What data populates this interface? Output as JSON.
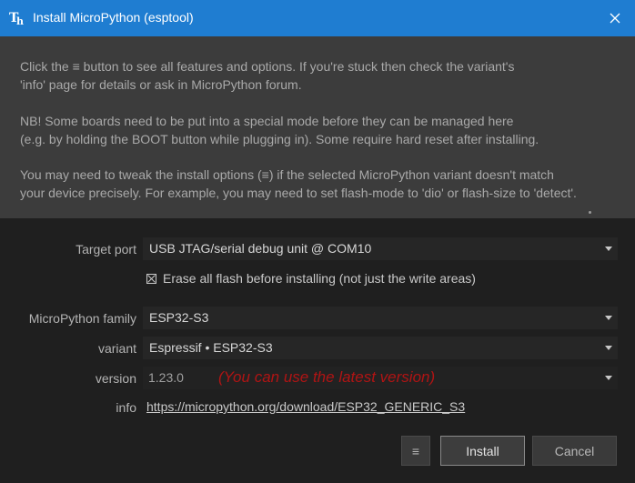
{
  "window": {
    "title": "Install MicroPython (esptool)",
    "close_glyph": "✕"
  },
  "info": {
    "para1_line1": "Click the ≡ button to see all features and options. If you're stuck then check the variant's",
    "para1_line2": "'info' page for details or ask in MicroPython forum.",
    "para2_line1": "NB! Some boards need to be put into a special mode before they can be managed here",
    "para2_line2": "(e.g. by holding the BOOT button while plugging in). Some require hard reset after installing.",
    "para3_line1": "You may need to tweak the install options (≡) if the selected MicroPython variant doesn't match",
    "para3_line2": "your device precisely. For example, you may need to set flash-mode to 'dio' or flash-size to 'detect'."
  },
  "form": {
    "target_port_label": "Target port",
    "target_port_value": "USB JTAG/serial debug unit @ COM10",
    "erase_label": "Erase all flash before installing (not just the write areas)",
    "family_label": "MicroPython family",
    "family_value": "ESP32-S3",
    "variant_label": "variant",
    "variant_value": "Espressif • ESP32-S3",
    "version_label": "version",
    "version_value": "1.23.0",
    "version_note": "(You can use the latest version)",
    "info_label": "info",
    "info_link": "https://micropython.org/download/ESP32_GENERIC_S3"
  },
  "buttons": {
    "menu_glyph": "≡",
    "install": "Install",
    "cancel": "Cancel"
  },
  "colors": {
    "title_bar": "#1f7dd1",
    "info_panel": "#3c3c3c",
    "background": "#1f1f1f",
    "note": "#b01414"
  },
  "icons": {
    "app": "thonny-icon",
    "close": "close-icon",
    "dropdown": "chevron-down-icon"
  }
}
